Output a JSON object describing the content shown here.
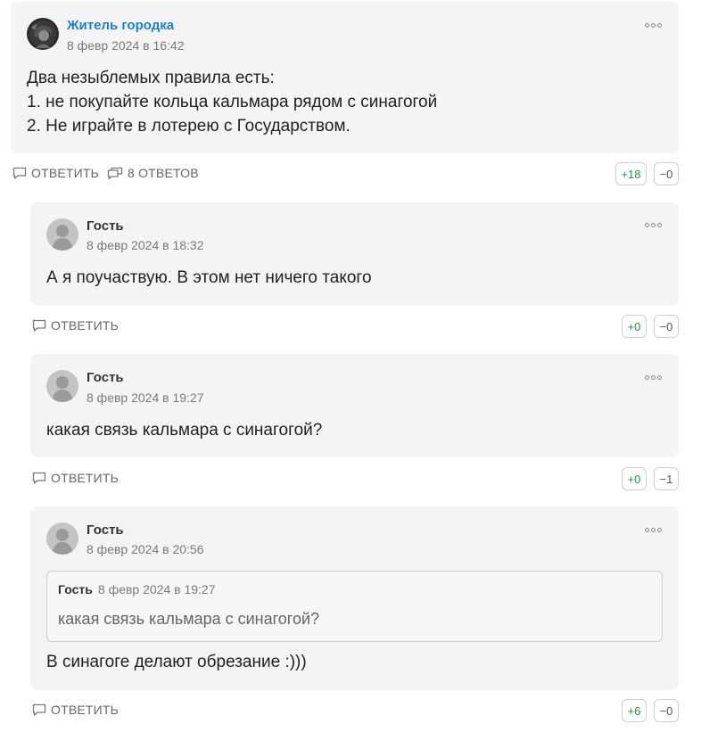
{
  "comments": [
    {
      "author": "Житель городка",
      "date": "8 февр 2024 в 16:42",
      "text_lines": [
        "Два незыблемых правила есть:",
        "1. не покупайте кольца кальмара рядом с синагогой",
        "2. Не играйте в лотерею с Государством."
      ],
      "reply_label": "ОТВЕТИТЬ",
      "replies_label": "8 ОТВЕТОВ",
      "votes_up": "+18",
      "votes_down": "−0"
    },
    {
      "author": "Гость",
      "date": "8 февр 2024 в 18:32",
      "text": "А я поучаствую. В этом нет ничего такого",
      "reply_label": "ОТВЕТИТЬ",
      "votes_up": "+0",
      "votes_down": "−0"
    },
    {
      "author": "Гость",
      "date": "8 февр 2024 в 19:27",
      "text": "какая связь кальмара с синагогой?",
      "reply_label": "ОТВЕТИТЬ",
      "votes_up": "+0",
      "votes_down": "−1"
    },
    {
      "author": "Гость",
      "date": "8 февр 2024 в 20:56",
      "quote": {
        "author": "Гость",
        "date": "8 февр 2024 в 19:27",
        "text": "какая связь кальмара с синагогой?"
      },
      "text": "В синагоге делают обрезание :)))",
      "reply_label": "ОТВЕТИТЬ",
      "votes_up": "+6",
      "votes_down": "−0"
    }
  ],
  "colors": {
    "author_link": "#1a7fd6",
    "vote_up": "#1e9a4a",
    "card_bg": "#f4f4f4"
  },
  "icons": {
    "reply": "speech-bubble-icon",
    "replies": "speech-bubbles-icon",
    "menu": "more-dots-icon",
    "avatar": "user-silhouette-icon"
  }
}
